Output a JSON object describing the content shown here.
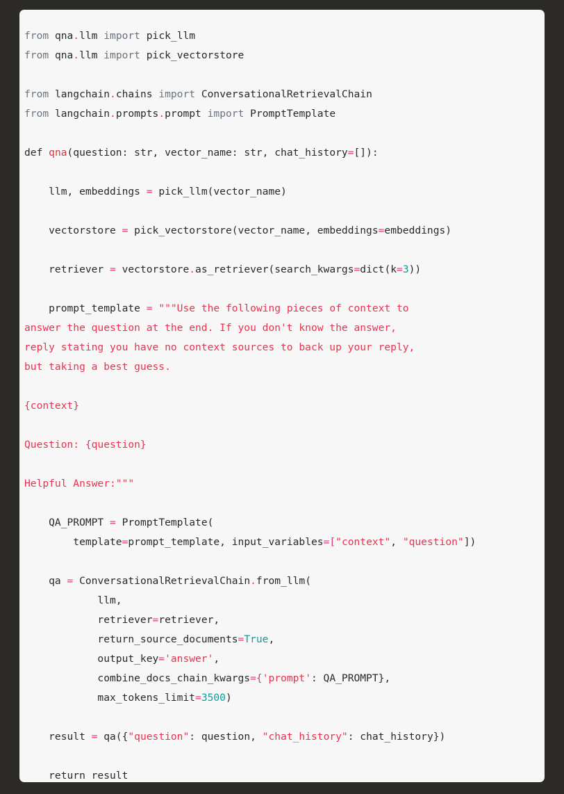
{
  "window": {
    "background_color": "#2b2a27",
    "panel_background_color": "#f7f7f7"
  },
  "editor": {
    "language": "python",
    "font_size_px": 14.6,
    "line_height_px": 28,
    "theme_colors": {
      "keyword": "#6a737d",
      "default_text": "#24292e",
      "function_name": "#d1383d",
      "operator": "#e0337a",
      "string": "#e8334f",
      "number": "#0f9b9b"
    },
    "lines": [
      [
        {
          "t": "from ",
          "c": "kw"
        },
        {
          "t": "qna",
          "c": "pl"
        },
        {
          "t": ".",
          "c": "op"
        },
        {
          "t": "llm ",
          "c": "pl"
        },
        {
          "t": "import ",
          "c": "kw"
        },
        {
          "t": "pick_llm",
          "c": "pl"
        }
      ],
      [
        {
          "t": "from ",
          "c": "kw"
        },
        {
          "t": "qna",
          "c": "pl"
        },
        {
          "t": ".",
          "c": "op"
        },
        {
          "t": "llm ",
          "c": "pl"
        },
        {
          "t": "import ",
          "c": "kw"
        },
        {
          "t": "pick_vectorstore",
          "c": "pl"
        }
      ],
      [],
      [
        {
          "t": "from ",
          "c": "kw"
        },
        {
          "t": "langchain",
          "c": "pl"
        },
        {
          "t": ".",
          "c": "op"
        },
        {
          "t": "chains ",
          "c": "pl"
        },
        {
          "t": "import ",
          "c": "kw"
        },
        {
          "t": "ConversationalRetrievalChain",
          "c": "pl"
        }
      ],
      [
        {
          "t": "from ",
          "c": "kw"
        },
        {
          "t": "langchain",
          "c": "pl"
        },
        {
          "t": ".",
          "c": "op"
        },
        {
          "t": "prompts",
          "c": "pl"
        },
        {
          "t": ".",
          "c": "op"
        },
        {
          "t": "prompt ",
          "c": "pl"
        },
        {
          "t": "import ",
          "c": "kw"
        },
        {
          "t": "PromptTemplate",
          "c": "pl"
        }
      ],
      [],
      [
        {
          "t": "def ",
          "c": "def"
        },
        {
          "t": "qna",
          "c": "fn"
        },
        {
          "t": "(question: str, vector_name: str, chat_history",
          "c": "pl"
        },
        {
          "t": "=",
          "c": "op"
        },
        {
          "t": "[]):",
          "c": "pl"
        }
      ],
      [],
      [
        {
          "t": "    llm, embeddings ",
          "c": "pl"
        },
        {
          "t": "=",
          "c": "op"
        },
        {
          "t": " pick_llm(vector_name)",
          "c": "pl"
        }
      ],
      [],
      [
        {
          "t": "    vectorstore ",
          "c": "pl"
        },
        {
          "t": "=",
          "c": "op"
        },
        {
          "t": " pick_vectorstore(vector_name, embeddings",
          "c": "pl"
        },
        {
          "t": "=",
          "c": "op"
        },
        {
          "t": "embeddings)",
          "c": "pl"
        }
      ],
      [],
      [
        {
          "t": "    retriever ",
          "c": "pl"
        },
        {
          "t": "=",
          "c": "op"
        },
        {
          "t": " vectorstore",
          "c": "pl"
        },
        {
          "t": ".",
          "c": "op"
        },
        {
          "t": "as_retriever(search_kwargs",
          "c": "pl"
        },
        {
          "t": "=",
          "c": "op"
        },
        {
          "t": "dict(k",
          "c": "pl"
        },
        {
          "t": "=",
          "c": "op"
        },
        {
          "t": "3",
          "c": "num"
        },
        {
          "t": "))",
          "c": "pl"
        }
      ],
      [],
      [
        {
          "t": "    prompt_template ",
          "c": "pl"
        },
        {
          "t": "=",
          "c": "op"
        },
        {
          "t": " \"\"\"Use the following pieces of context to",
          "c": "str"
        }
      ],
      [
        {
          "t": "answer the question at the end. If you don't know the answer,",
          "c": "str"
        }
      ],
      [
        {
          "t": "reply stating you have no context sources to back up your reply,",
          "c": "str"
        }
      ],
      [
        {
          "t": "but taking a best guess.",
          "c": "str"
        }
      ],
      [],
      [
        {
          "t": "{context}",
          "c": "str"
        }
      ],
      [],
      [
        {
          "t": "Question: {question}",
          "c": "str"
        }
      ],
      [],
      [
        {
          "t": "Helpful Answer:\"\"\"",
          "c": "str"
        }
      ],
      [],
      [
        {
          "t": "    QA_PROMPT ",
          "c": "pl"
        },
        {
          "t": "=",
          "c": "op"
        },
        {
          "t": " PromptTemplate(",
          "c": "pl"
        }
      ],
      [
        {
          "t": "        template",
          "c": "pl"
        },
        {
          "t": "=",
          "c": "op"
        },
        {
          "t": "prompt_template, input_variables",
          "c": "pl"
        },
        {
          "t": "=",
          "c": "op"
        },
        {
          "t": "[",
          "c": "op"
        },
        {
          "t": "\"context\"",
          "c": "str"
        },
        {
          "t": ", ",
          "c": "pl"
        },
        {
          "t": "\"question\"",
          "c": "str"
        },
        {
          "t": "])",
          "c": "pl"
        }
      ],
      [],
      [
        {
          "t": "    qa ",
          "c": "pl"
        },
        {
          "t": "=",
          "c": "op"
        },
        {
          "t": " ConversationalRetrievalChain",
          "c": "pl"
        },
        {
          "t": ".",
          "c": "op"
        },
        {
          "t": "from_llm(",
          "c": "pl"
        }
      ],
      [
        {
          "t": "            llm,",
          "c": "pl"
        }
      ],
      [
        {
          "t": "            retriever",
          "c": "pl"
        },
        {
          "t": "=",
          "c": "op"
        },
        {
          "t": "retriever,",
          "c": "pl"
        }
      ],
      [
        {
          "t": "            return_source_documents",
          "c": "pl"
        },
        {
          "t": "=",
          "c": "op"
        },
        {
          "t": "True",
          "c": "num"
        },
        {
          "t": ",",
          "c": "pl"
        }
      ],
      [
        {
          "t": "            output_key",
          "c": "pl"
        },
        {
          "t": "=",
          "c": "op"
        },
        {
          "t": "'answer'",
          "c": "str"
        },
        {
          "t": ",",
          "c": "pl"
        }
      ],
      [
        {
          "t": "            combine_docs_chain_kwargs",
          "c": "pl"
        },
        {
          "t": "=",
          "c": "op"
        },
        {
          "t": "{",
          "c": "op"
        },
        {
          "t": "'prompt'",
          "c": "str"
        },
        {
          "t": ": QA_PROMPT},",
          "c": "pl"
        }
      ],
      [
        {
          "t": "            max_tokens_limit",
          "c": "pl"
        },
        {
          "t": "=",
          "c": "op"
        },
        {
          "t": "3500",
          "c": "num"
        },
        {
          "t": ")",
          "c": "pl"
        }
      ],
      [],
      [
        {
          "t": "    result ",
          "c": "pl"
        },
        {
          "t": "=",
          "c": "op"
        },
        {
          "t": " qa({",
          "c": "pl"
        },
        {
          "t": "\"question\"",
          "c": "str"
        },
        {
          "t": ": question, ",
          "c": "pl"
        },
        {
          "t": "\"chat_history\"",
          "c": "str"
        },
        {
          "t": ": chat_history})",
          "c": "pl"
        }
      ],
      [],
      [
        {
          "t": "    return result",
          "c": "pl"
        }
      ]
    ]
  }
}
